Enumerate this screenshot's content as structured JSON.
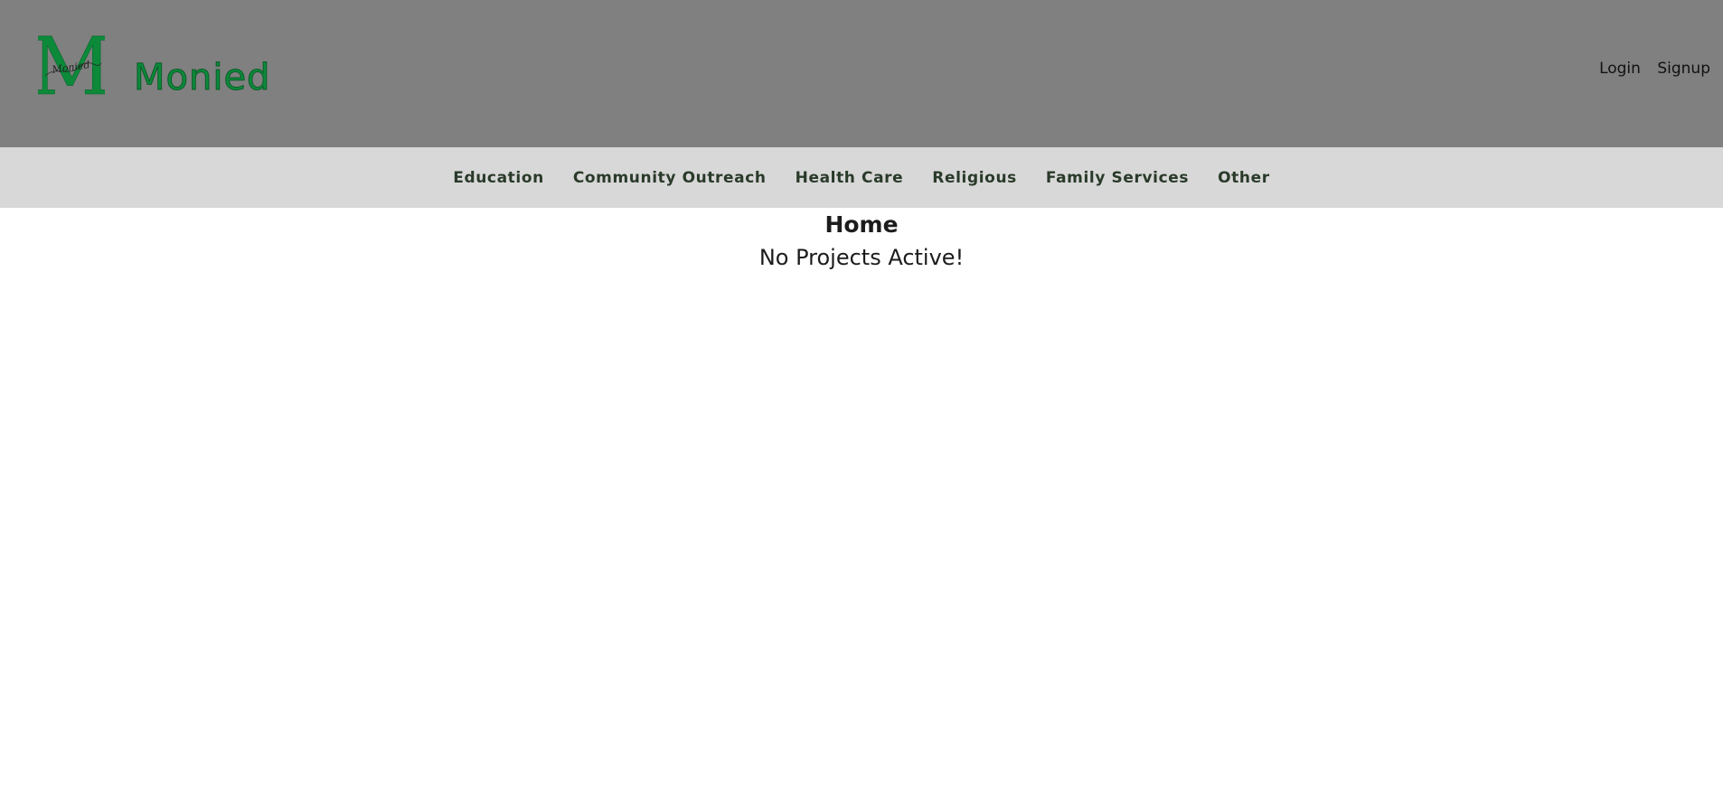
{
  "brand": {
    "name": "Monied",
    "logo_letter": "M",
    "logo_script": "Monied",
    "accent_color": "#0c8a3a"
  },
  "auth": {
    "login_label": "Login",
    "signup_label": "Signup"
  },
  "nav": {
    "items": [
      {
        "label": "Education"
      },
      {
        "label": "Community Outreach"
      },
      {
        "label": "Health Care"
      },
      {
        "label": "Religious"
      },
      {
        "label": "Family Services"
      },
      {
        "label": "Other"
      }
    ]
  },
  "main": {
    "title": "Home",
    "status_message": "No Projects Active!"
  }
}
